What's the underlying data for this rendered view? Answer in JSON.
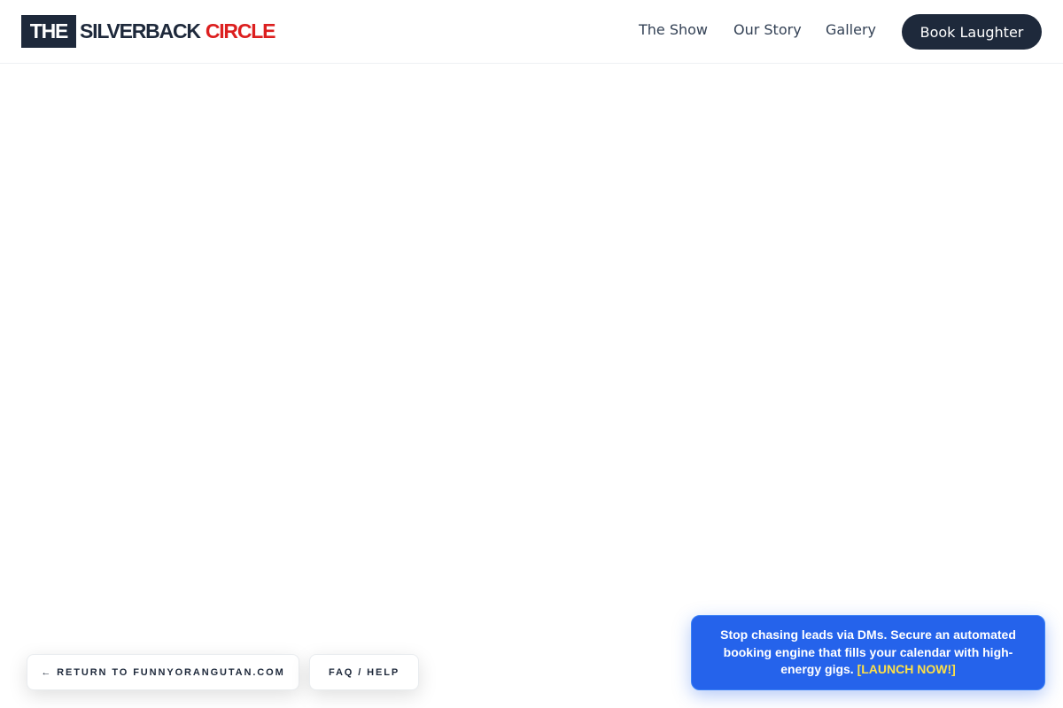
{
  "header": {
    "logo": {
      "the": "THE",
      "silverback": "SILVERBACK",
      "circle": "CIRCLE"
    },
    "nav": {
      "the_show": "The Show",
      "our_story": "Our Story",
      "gallery": "Gallery"
    },
    "cta_label": "Book Laughter"
  },
  "footer_links": {
    "return_label": "← RETURN TO FUNNYORANGUTAN.COM",
    "faq_label": "FAQ / HELP"
  },
  "promo": {
    "text": "Stop chasing leads via DMs. Secure an automated booking engine that fills your calendar with high-energy gigs.",
    "link_label": "[LAUNCH NOW!]"
  },
  "colors": {
    "brand_dark": "#1e293b",
    "brand_red": "#dc1f1f",
    "promo_blue": "#2563eb",
    "promo_link": "#fde047"
  }
}
